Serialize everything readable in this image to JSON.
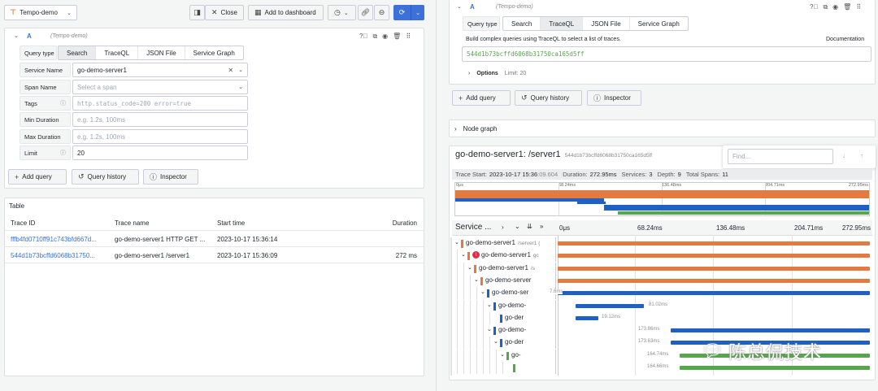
{
  "toolbar": {
    "datasource": "Tempo-demo",
    "close_label": "Close",
    "add_dashboard_label": "Add to dashboard"
  },
  "left_query": {
    "letter": "A",
    "datasource_tag": "(Tempo-demo)",
    "query_type_label": "Query type",
    "tabs": [
      "Search",
      "TraceQL",
      "JSON File",
      "Service Graph"
    ],
    "fields": {
      "service_name_label": "Service Name",
      "service_name_value": "go-demo-server1",
      "span_name_label": "Span Name",
      "span_name_placeholder": "Select a span",
      "tags_label": "Tags",
      "tags_placeholder": "http.status_code=200 error=true",
      "min_duration_label": "Min Duration",
      "min_duration_placeholder": "e.g. 1.2s, 100ms",
      "max_duration_label": "Max Duration",
      "max_duration_placeholder": "e.g. 1.2s, 100ms",
      "limit_label": "Limit",
      "limit_value": "20"
    },
    "buttons": {
      "add_query": "Add query",
      "query_history": "Query history",
      "inspector": "Inspector"
    }
  },
  "table": {
    "title": "Table",
    "columns": [
      "Trace ID",
      "Trace name",
      "Start time",
      "Duration"
    ],
    "rows": [
      {
        "id": "fffb4fd0710ff91c743bfd667d...",
        "name": "go-demo-server1 HTTP GET ...",
        "start": "2023-10-17 15:36:14",
        "duration": ""
      },
      {
        "id": "544d1b73bcffd6068b31750...",
        "name": "go-demo-server1 /server1",
        "start": "2023-10-17 15:36:09",
        "duration": "272 ms"
      }
    ]
  },
  "right_query": {
    "letter": "A",
    "datasource_tag": "(Tempo-demo)",
    "query_type_label": "Query type",
    "tabs": [
      "Search",
      "TraceQL",
      "JSON File",
      "Service Graph"
    ],
    "help_text": "Build complex queries using TraceQL to select a list of traces.",
    "documentation": "Documentation",
    "query_value": "544d1b73bcffd6068b31750ca165d5ff",
    "options_label": "Options",
    "options_limit": "Limit: 20",
    "buttons": {
      "add_query": "Add query",
      "query_history": "Query history",
      "inspector": "Inspector"
    }
  },
  "node_graph": {
    "label": "Node graph"
  },
  "trace": {
    "title": "go-demo-server1: /server1",
    "trace_id": "544d1b73bcffd6068b31750ca165d5ff",
    "find_placeholder": "Find...",
    "meta": {
      "start_label": "Trace Start:",
      "start_value": "2023-10-17 15:36",
      "start_ms": ":09.604",
      "duration_label": "Duration:",
      "duration_value": "272.95ms",
      "services_label": "Services:",
      "services_value": "3",
      "depth_label": "Depth:",
      "depth_value": "9",
      "spans_label": "Total Spans:",
      "spans_value": "11"
    },
    "mini_ticks": [
      "0μs",
      "68.24ms",
      "136.48ms",
      "204.71ms",
      "272.95ms"
    ],
    "header_label": "Service ...",
    "ticks": [
      "0μs",
      "68.24ms",
      "136.48ms",
      "204.71ms",
      "272.95ms"
    ],
    "spans": [
      {
        "service": "go-demo-server1",
        "op": "/server1 (",
        "duration": ""
      },
      {
        "service": "go-demo-server1",
        "op": "gc",
        "duration": ""
      },
      {
        "service": "go-demo-server1",
        "op": "/s",
        "duration": ""
      },
      {
        "service": "go-demo-server",
        "op": "",
        "duration": ""
      },
      {
        "service": "go-demo-ser",
        "op": "",
        "duration": "7.6ms"
      },
      {
        "service": "go-demo-",
        "op": "",
        "duration": "81.02ms"
      },
      {
        "service": "go-der",
        "op": "",
        "duration": "19.12ms"
      },
      {
        "service": "go-demo-",
        "op": "",
        "duration": "173.86ms"
      },
      {
        "service": "go-der",
        "op": "",
        "duration": "173.63ms"
      },
      {
        "service": "go-",
        "op": "",
        "duration": "164.74ms"
      },
      {
        "service": "",
        "op": "",
        "duration": "164.66ms"
      }
    ]
  },
  "watermark": "陈总侃技术",
  "colors": {
    "server1": "#e37b40",
    "server2": "#1f60c4",
    "server3": "#56a64b",
    "link": "#3871dc",
    "primary": "#3d71d9"
  }
}
